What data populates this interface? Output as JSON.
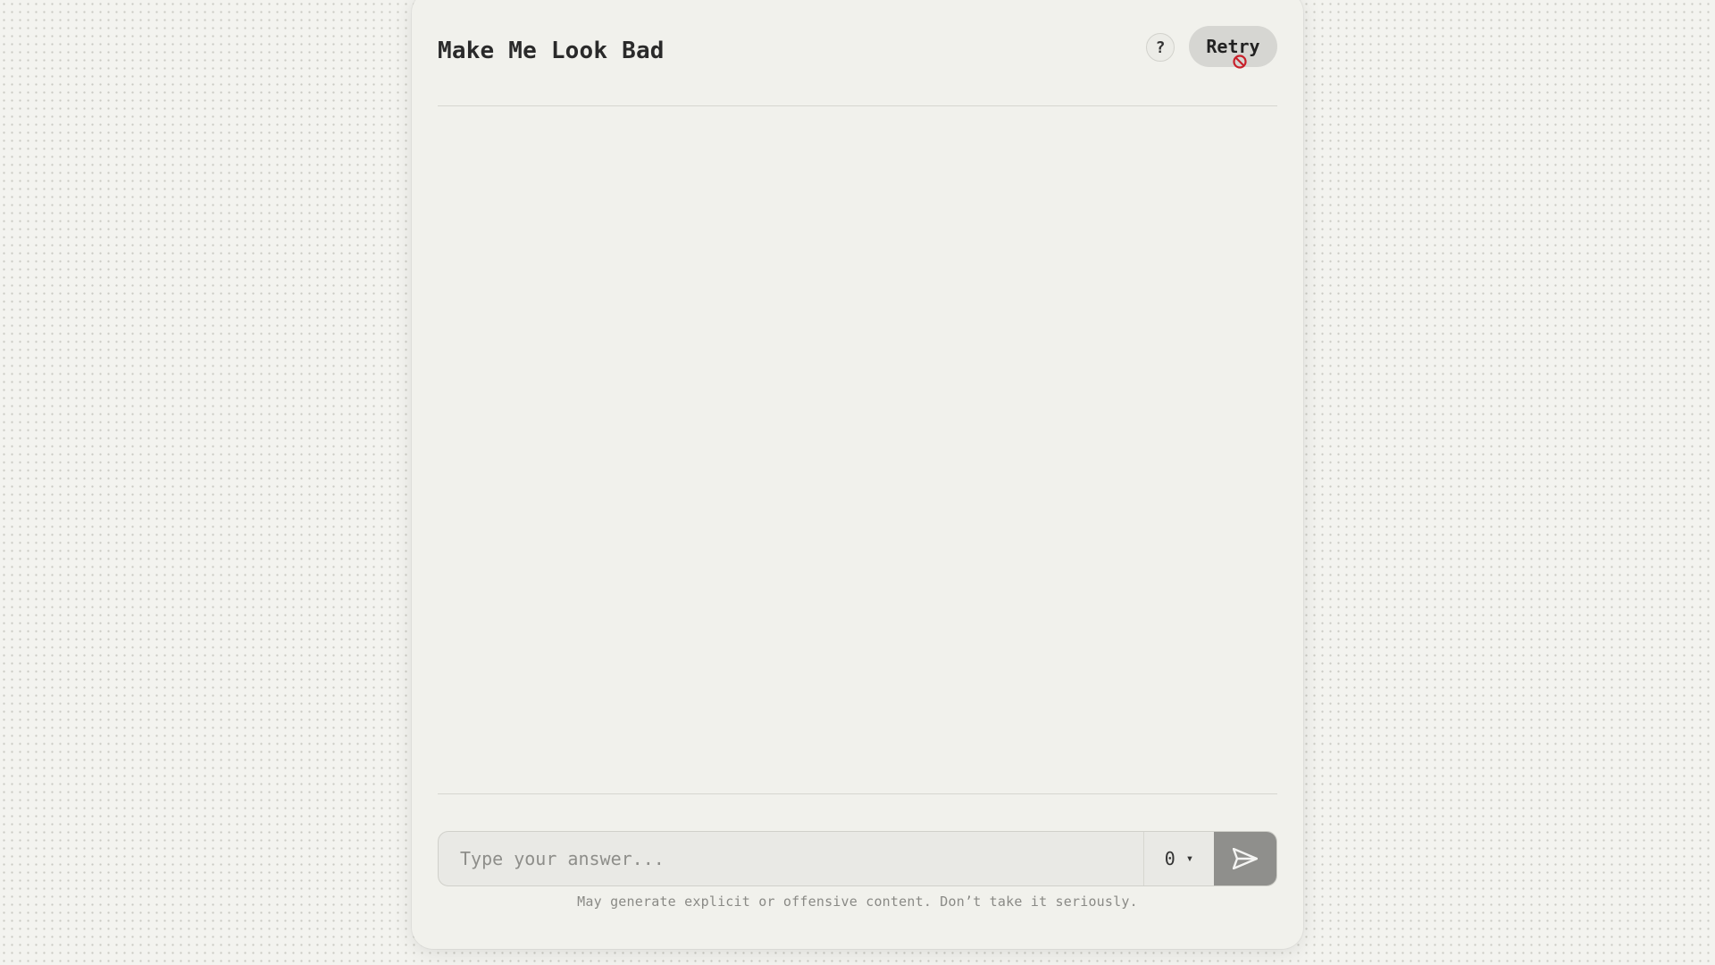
{
  "app": {
    "title": "Make Me Look Bad"
  },
  "header": {
    "help_label": "?",
    "retry_label": "Retry"
  },
  "composer": {
    "placeholder": "Type your answer...",
    "value": "",
    "count_value": "0",
    "count_caret": "▾",
    "send_icon": "send-arrow-icon"
  },
  "footer": {
    "disclaimer": "May generate explicit or offensive content. Don’t take it seriously."
  },
  "colors": {
    "background": "#f3f3ef",
    "card": "#f1f1ec",
    "retry_button": "#d6d6d2",
    "send_button": "#8f8f8c",
    "cursor_forbidden": "#c8202a"
  }
}
